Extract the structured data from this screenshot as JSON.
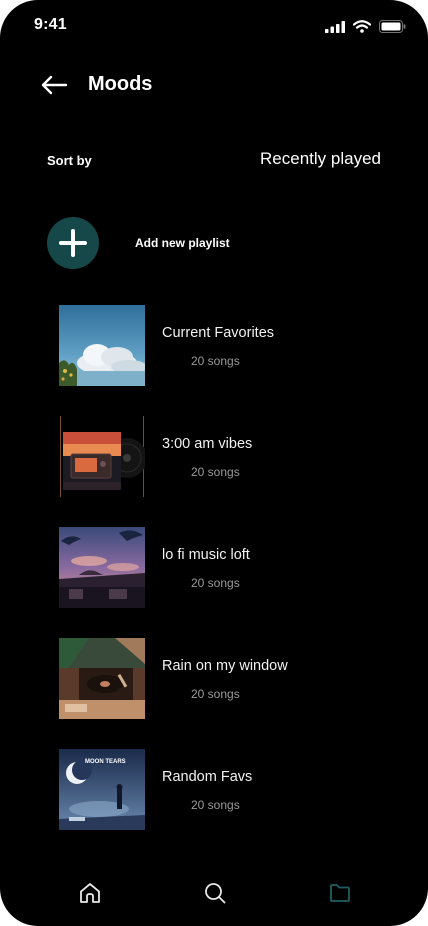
{
  "status_bar": {
    "time": "9:41"
  },
  "header": {
    "title": "Moods"
  },
  "sort": {
    "label": "Sort by",
    "value": "Recently played"
  },
  "add_playlist": {
    "label": "Add new  playlist"
  },
  "colors": {
    "accent": "#16484a",
    "nav_active": "#1f5f63",
    "background": "#000000",
    "muted_text": "#9a9a9a"
  },
  "playlists": [
    {
      "title": "Current Favorites",
      "count": "20 songs"
    },
    {
      "title": "3:00 am vibes",
      "count": "20 songs"
    },
    {
      "title": "lo fi music loft",
      "count": "20 songs"
    },
    {
      "title": "Rain on my window",
      "count": "20 songs"
    },
    {
      "title": "Random Favs",
      "count": "20 songs",
      "cover_text": "MOON TEARS"
    }
  ],
  "bottom_nav": {
    "items": [
      {
        "icon": "home-icon"
      },
      {
        "icon": "search-icon"
      },
      {
        "icon": "folder-icon",
        "active": true
      }
    ]
  }
}
